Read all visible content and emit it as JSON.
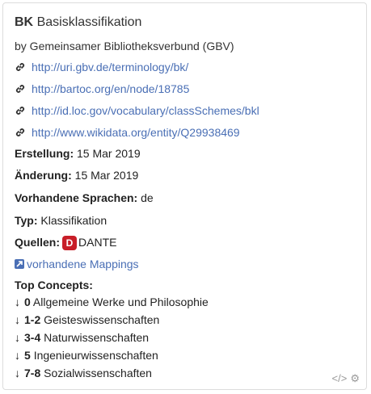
{
  "header": {
    "notation": "BK",
    "title": "Basisklassifikation"
  },
  "publisher": "by Gemeinsamer Bibliotheksverbund (GBV)",
  "links": [
    "http://uri.gbv.de/terminology/bk/",
    "http://bartoc.org/en/node/18785",
    "http://id.loc.gov/vocabulary/classSchemes/bkl",
    "http://www.wikidata.org/entity/Q29938469"
  ],
  "created": {
    "label": "Erstellung:",
    "value": "15 Mar 2019"
  },
  "modified": {
    "label": "Änderung:",
    "value": "15 Mar 2019"
  },
  "languages": {
    "label": "Vorhandene Sprachen:",
    "value": "de"
  },
  "type": {
    "label": "Typ:",
    "value": "Klassifikation"
  },
  "sources": {
    "label": "Quellen:",
    "badge": "D",
    "value": "DANTE",
    "badge_color": "#c81e28"
  },
  "mappings_link": "vorhandene Mappings",
  "top_concepts": {
    "label": "Top Concepts:",
    "items": [
      {
        "notation": "0",
        "label": "Allgemeine Werke und Philosophie"
      },
      {
        "notation": "1-2",
        "label": "Geisteswissenschaften"
      },
      {
        "notation": "3-4",
        "label": "Naturwissenschaften"
      },
      {
        "notation": "5",
        "label": "Ingenieurwissenschaften"
      },
      {
        "notation": "7-8",
        "label": "Sozialwissenschaften"
      }
    ]
  },
  "footer": {
    "code_icon": "code-icon",
    "settings_icon": "gear-icon",
    "code_glyph": "</>",
    "gear_glyph": "⚙"
  },
  "colors": {
    "link": "#4a6fb5",
    "text": "#222222",
    "border": "#dcdcdc"
  }
}
